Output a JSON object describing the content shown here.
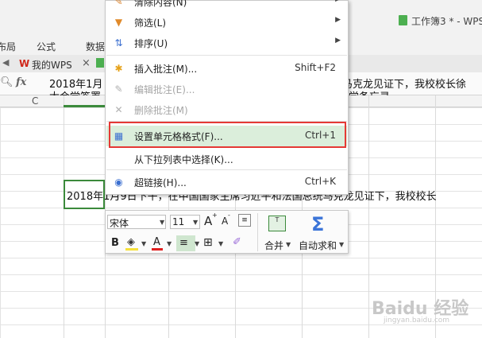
{
  "window": {
    "title": "工作簿3 * - WPS"
  },
  "ribbon": {
    "tabs": [
      "布局",
      "公式",
      "数据"
    ]
  },
  "doc_tabs": {
    "wps_tab_label": "我的WPS",
    "close_glyph": "×"
  },
  "formula_bar": {
    "fx": "fx",
    "line1": "2018年1月",
    "line1_tail": "马克龙见证下，我校校长徐",
    "line2": "大会堂签署",
    "line2_tail": "学备忘录。"
  },
  "columns": {
    "c": "C"
  },
  "cell": {
    "text": "2018年1月9日下午，在中国国家主席习近平和法国总统马克龙见证下，我校校长"
  },
  "context_menu": {
    "items": [
      {
        "label": "清除内容(N)",
        "shortcut": "",
        "submenu": true,
        "disabled": false,
        "icon": "eraser-icon"
      },
      {
        "label": "筛选(L)",
        "shortcut": "",
        "submenu": true,
        "disabled": false,
        "icon": "filter-icon"
      },
      {
        "label": "排序(U)",
        "shortcut": "",
        "submenu": true,
        "disabled": false,
        "icon": "sort-icon"
      },
      {
        "label": "插入批注(M)...",
        "shortcut": "Shift+F2",
        "submenu": false,
        "disabled": false,
        "icon": "insert-comment-icon"
      },
      {
        "label": "编辑批注(E)...",
        "shortcut": "",
        "submenu": false,
        "disabled": true,
        "icon": "edit-comment-icon"
      },
      {
        "label": "删除批注(M)",
        "shortcut": "",
        "submenu": false,
        "disabled": true,
        "icon": "delete-comment-icon"
      },
      {
        "label": "设置单元格格式(F)...",
        "shortcut": "Ctrl+1",
        "submenu": false,
        "disabled": false,
        "icon": "format-cells-icon",
        "highlighted": true
      },
      {
        "label": "从下拉列表中选择(K)...",
        "shortcut": "",
        "submenu": false,
        "disabled": false,
        "icon": ""
      },
      {
        "label": "超链接(H)...",
        "shortcut": "Ctrl+K",
        "submenu": false,
        "disabled": false,
        "icon": "hyperlink-icon"
      }
    ]
  },
  "mini_toolbar": {
    "font_name": "宋体",
    "font_size": "11",
    "bold": "B",
    "font_color": "A",
    "grow_font": "A",
    "shrink_font": "A",
    "merge_label": "合并",
    "autosum_label": "自动求和",
    "merge_icon_text": "T"
  },
  "watermark": {
    "text": "Baidu 经验",
    "sub": "jingyan.baidu.com"
  },
  "colors": {
    "accent_green": "#3b8a3b",
    "highlight_red": "#e53935",
    "menu_highlight": "#dbeedb"
  }
}
